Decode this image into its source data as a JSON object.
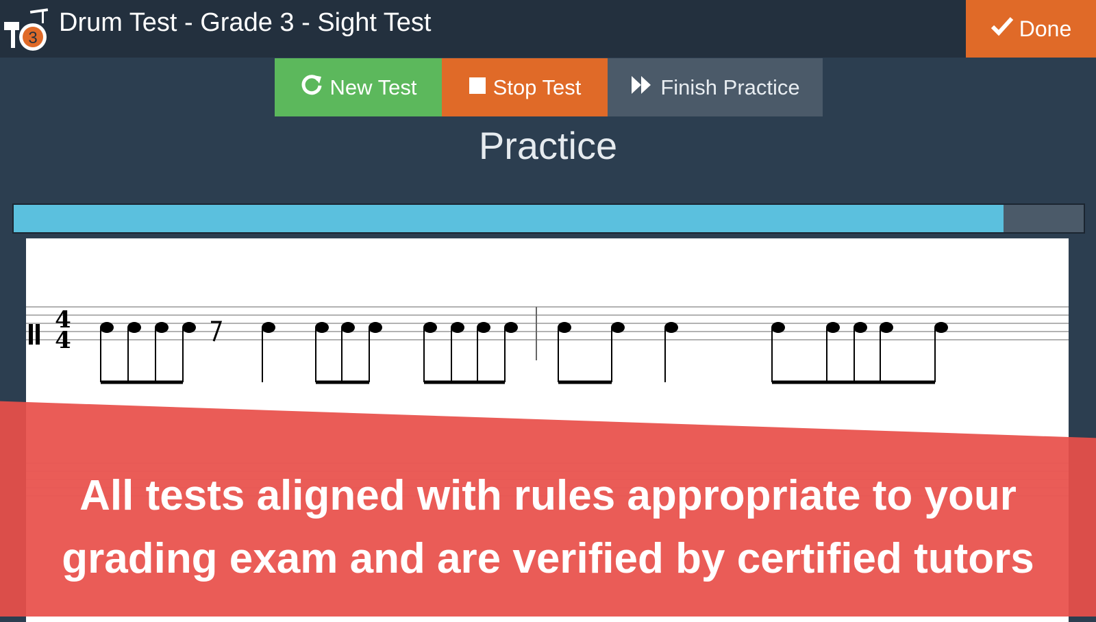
{
  "header": {
    "title": "Drum Test - Grade 3 -  Sight Test",
    "grade_badge": "3",
    "done_label": "Done"
  },
  "toolbar": {
    "new_test": "New Test",
    "stop_test": "Stop Test",
    "finish_practice": "Finish Practice"
  },
  "mode_title": "Practice",
  "progress": {
    "fraction": 0.925
  },
  "score": {
    "time_signature_top": "4",
    "time_signature_bottom": "4"
  },
  "banner": {
    "line1": "All tests aligned with rules appropriate to your",
    "line2": "grading exam and are verified by certified tutors"
  },
  "colors": {
    "header_bg": "#23303e",
    "page_bg": "#2c3e50",
    "green": "#5cb85c",
    "orange": "#e06a28",
    "gray_button": "#4b5a69",
    "progress_fill": "#5bc0de",
    "banner_red": "#e8504a"
  },
  "icons": {
    "refresh": "refresh-icon",
    "stop": "stop-icon",
    "fast_forward": "fast-forward-icon",
    "check": "check-icon",
    "app": "drum-kit-icon"
  }
}
